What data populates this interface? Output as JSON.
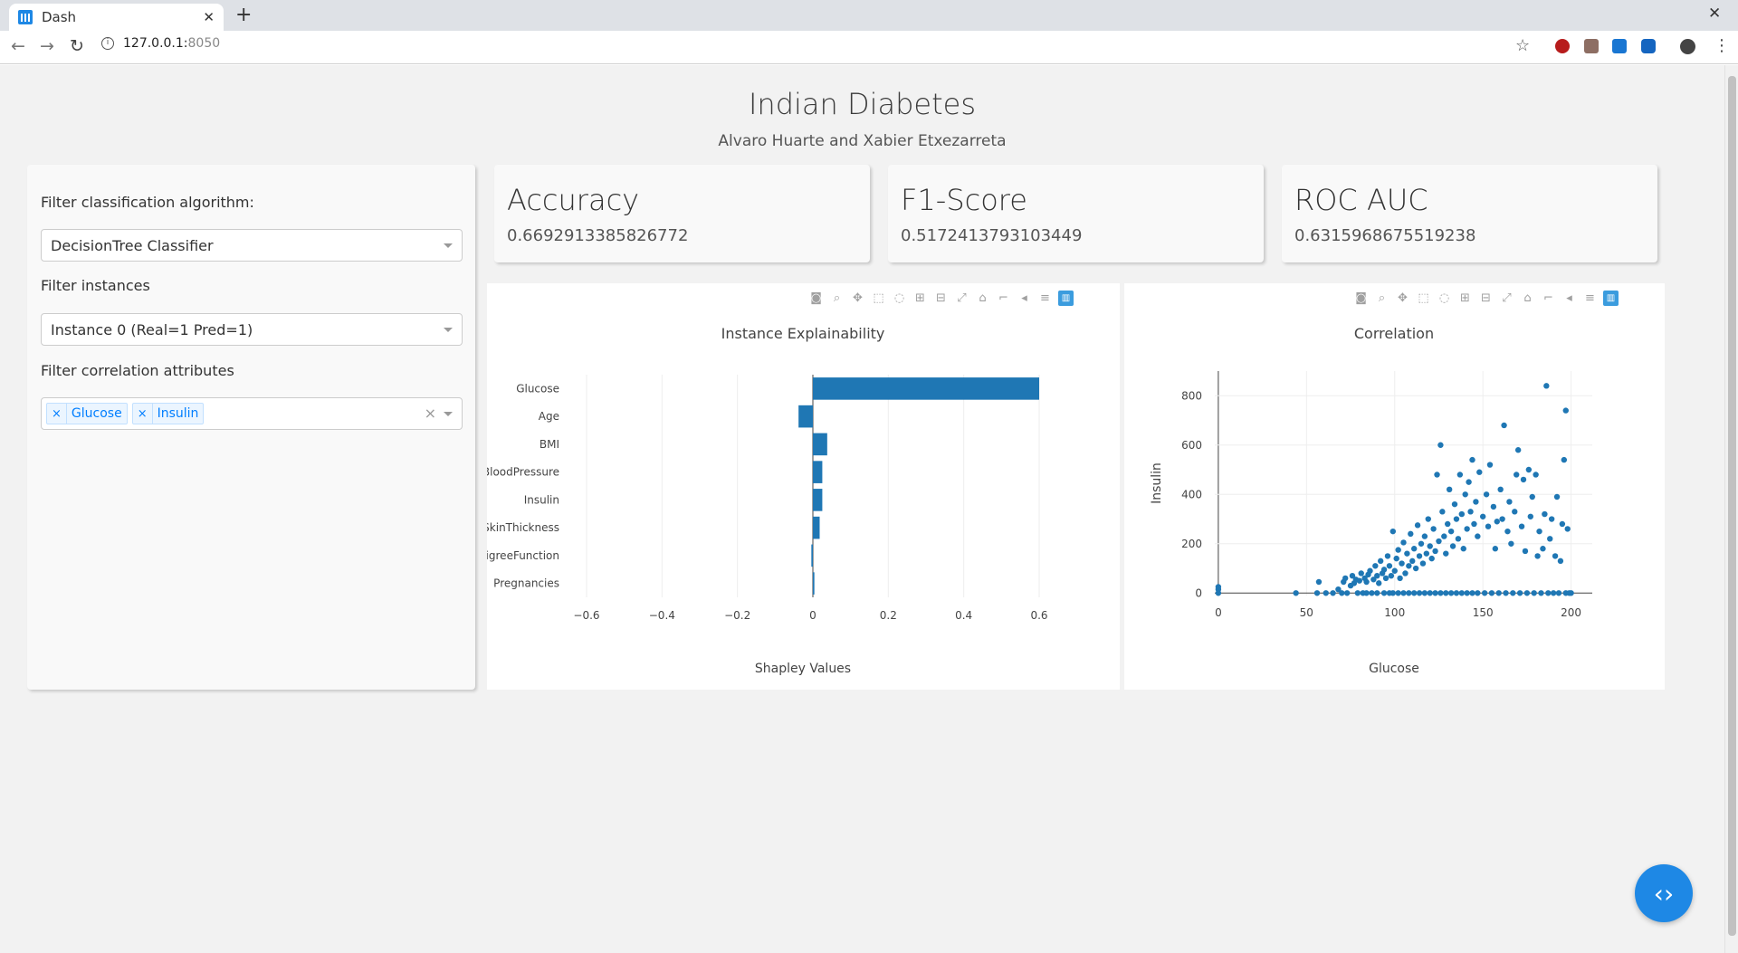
{
  "browser": {
    "tab_title": "Dash",
    "tab_close": "✕",
    "new_tab": "+",
    "window_close": "✕",
    "url_host": "127.0.0.1:",
    "url_port": "8050"
  },
  "header": {
    "title": "Indian Diabetes",
    "subtitle": "Alvaro Huarte and Xabier Etxezarreta"
  },
  "filters": {
    "algorithm_label": "Filter classification algorithm:",
    "algorithm_value": "DecisionTree Classifier",
    "instances_label": "Filter instances",
    "instances_value": "Instance 0 (Real=1 Pred=1)",
    "correlation_label": "Filter correlation attributes",
    "correlation_values": [
      "Glucose",
      "Insulin"
    ],
    "chip_remove": "×",
    "clear_all": "×"
  },
  "metrics": [
    {
      "label": "Accuracy",
      "value": "0.6692913385826772"
    },
    {
      "label": "F1-Score",
      "value": "0.5172413793103449"
    },
    {
      "label": "ROC AUC",
      "value": "0.6315968675519238"
    }
  ],
  "colors": {
    "accent": "#1f77b4",
    "fab": "#1e88e5",
    "page_bg": "#f2f2f2"
  },
  "modebar_icons": [
    "camera-icon",
    "zoom-icon",
    "pan-icon",
    "box-select-icon",
    "lasso-icon",
    "zoom-in-icon",
    "zoom-out-icon",
    "autoscale-icon",
    "reset-axes-icon",
    "spike-lines-icon",
    "hover-closest-icon",
    "hover-compare-icon",
    "plotly-logo-icon"
  ],
  "chart_data": [
    {
      "type": "bar",
      "orientation": "horizontal",
      "title": "Instance Explainability",
      "xlabel": "Shapley Values",
      "ylabel": "",
      "xlim": [
        -0.6,
        0.6
      ],
      "xticks": [
        -0.6,
        -0.4,
        -0.2,
        0,
        0.2,
        0.4,
        0.6
      ],
      "xtick_labels": [
        "−0.6",
        "−0.4",
        "−0.2",
        "0",
        "0.2",
        "0.4",
        "0.6"
      ],
      "categories": [
        "Glucose",
        "Age",
        "BMI",
        "BloodPressure",
        "Insulin",
        "SkinThickness",
        "DiabetesPedigreeFunction",
        "Pregnancies"
      ],
      "values": [
        0.6,
        -0.038,
        0.038,
        0.025,
        0.025,
        0.018,
        -0.004,
        0.004
      ],
      "grid": true
    },
    {
      "type": "scatter",
      "title": "Correlation",
      "xlabel": "Glucose",
      "ylabel": "Insulin",
      "xlim": [
        -2,
        212
      ],
      "ylim": [
        -10,
        900
      ],
      "xticks": [
        0,
        50,
        100,
        150,
        200
      ],
      "yticks": [
        0,
        200,
        400,
        600,
        800
      ],
      "grid": true,
      "points": [
        [
          0,
          0
        ],
        [
          0,
          15
        ],
        [
          0,
          25
        ],
        [
          44,
          0
        ],
        [
          56,
          0
        ],
        [
          57,
          45
        ],
        [
          61,
          0
        ],
        [
          65,
          0
        ],
        [
          68,
          15
        ],
        [
          70,
          0
        ],
        [
          71,
          45
        ],
        [
          72,
          60
        ],
        [
          73,
          0
        ],
        [
          75,
          30
        ],
        [
          76,
          70
        ],
        [
          77,
          40
        ],
        [
          78,
          55
        ],
        [
          79,
          0
        ],
        [
          80,
          50
        ],
        [
          81,
          80
        ],
        [
          82,
          0
        ],
        [
          83,
          60
        ],
        [
          84,
          45
        ],
        [
          84,
          0
        ],
        [
          85,
          75
        ],
        [
          86,
          90
        ],
        [
          87,
          0
        ],
        [
          88,
          55
        ],
        [
          89,
          110
        ],
        [
          90,
          70
        ],
        [
          90,
          0
        ],
        [
          91,
          40
        ],
        [
          92,
          130
        ],
        [
          93,
          80
        ],
        [
          94,
          0
        ],
        [
          94,
          95
        ],
        [
          95,
          60
        ],
        [
          96,
          150
        ],
        [
          97,
          0
        ],
        [
          97,
          110
        ],
        [
          98,
          70
        ],
        [
          99,
          250
        ],
        [
          99,
          0
        ],
        [
          100,
          90
        ],
        [
          101,
          140
        ],
        [
          102,
          0
        ],
        [
          102,
          175
        ],
        [
          103,
          60
        ],
        [
          104,
          120
        ],
        [
          105,
          0
        ],
        [
          105,
          205
        ],
        [
          106,
          80
        ],
        [
          107,
          160
        ],
        [
          108,
          0
        ],
        [
          108,
          110
        ],
        [
          109,
          240
        ],
        [
          110,
          130
        ],
        [
          111,
          0
        ],
        [
          111,
          180
        ],
        [
          112,
          100
        ],
        [
          113,
          275
        ],
        [
          114,
          0
        ],
        [
          114,
          150
        ],
        [
          115,
          200
        ],
        [
          116,
          120
        ],
        [
          117,
          0
        ],
        [
          117,
          230
        ],
        [
          118,
          160
        ],
        [
          119,
          300
        ],
        [
          120,
          0
        ],
        [
          120,
          190
        ],
        [
          121,
          140
        ],
        [
          122,
          260
        ],
        [
          123,
          0
        ],
        [
          123,
          170
        ],
        [
          124,
          480
        ],
        [
          125,
          210
        ],
        [
          126,
          0
        ],
        [
          126,
          600
        ],
        [
          127,
          330
        ],
        [
          128,
          230
        ],
        [
          129,
          0
        ],
        [
          129,
          160
        ],
        [
          130,
          280
        ],
        [
          131,
          420
        ],
        [
          132,
          0
        ],
        [
          132,
          250
        ],
        [
          133,
          190
        ],
        [
          134,
          360
        ],
        [
          135,
          0
        ],
        [
          135,
          300
        ],
        [
          136,
          220
        ],
        [
          137,
          480
        ],
        [
          138,
          0
        ],
        [
          138,
          320
        ],
        [
          139,
          180
        ],
        [
          140,
          400
        ],
        [
          141,
          0
        ],
        [
          141,
          260
        ],
        [
          142,
          450
        ],
        [
          143,
          330
        ],
        [
          144,
          0
        ],
        [
          144,
          540
        ],
        [
          145,
          280
        ],
        [
          146,
          370
        ],
        [
          147,
          0
        ],
        [
          147,
          230
        ],
        [
          148,
          490
        ],
        [
          150,
          310
        ],
        [
          151,
          0
        ],
        [
          152,
          400
        ],
        [
          153,
          270
        ],
        [
          154,
          520
        ],
        [
          155,
          0
        ],
        [
          156,
          350
        ],
        [
          157,
          180
        ],
        [
          158,
          290
        ],
        [
          159,
          0
        ],
        [
          160,
          420
        ],
        [
          161,
          300
        ],
        [
          162,
          680
        ],
        [
          163,
          0
        ],
        [
          164,
          250
        ],
        [
          165,
          370
        ],
        [
          166,
          200
        ],
        [
          167,
          0
        ],
        [
          168,
          330
        ],
        [
          169,
          480
        ],
        [
          170,
          580
        ],
        [
          171,
          0
        ],
        [
          172,
          270
        ],
        [
          173,
          460
        ],
        [
          174,
          170
        ],
        [
          175,
          0
        ],
        [
          176,
          500
        ],
        [
          177,
          310
        ],
        [
          178,
          390
        ],
        [
          179,
          0
        ],
        [
          180,
          480
        ],
        [
          181,
          150
        ],
        [
          182,
          250
        ],
        [
          183,
          0
        ],
        [
          184,
          180
        ],
        [
          185,
          320
        ],
        [
          186,
          840
        ],
        [
          187,
          0
        ],
        [
          188,
          220
        ],
        [
          189,
          300
        ],
        [
          190,
          0
        ],
        [
          191,
          150
        ],
        [
          192,
          390
        ],
        [
          193,
          0
        ],
        [
          194,
          130
        ],
        [
          195,
          280
        ],
        [
          196,
          540
        ],
        [
          197,
          0
        ],
        [
          197,
          740
        ],
        [
          198,
          260
        ],
        [
          199,
          0
        ],
        [
          200,
          0
        ]
      ]
    }
  ]
}
